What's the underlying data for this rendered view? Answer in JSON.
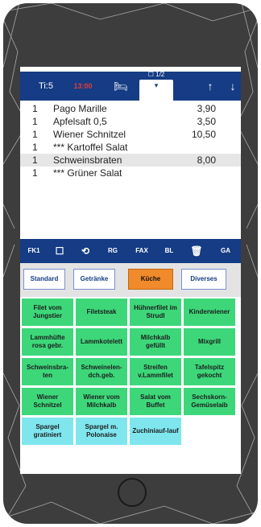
{
  "topbar": {
    "table": "Ti:5",
    "time": "13:00",
    "bed_icon": "bed-icon",
    "tab_label": "▾",
    "tab_sel": "☐ 1/2",
    "up_icon": "arrow-up-icon",
    "down_icon": "arrow-down-icon"
  },
  "orders": [
    {
      "qty": "1",
      "name": "Pago Marille",
      "price": "3,90"
    },
    {
      "qty": "1",
      "name": "Apfelsaft 0,5",
      "price": "3,50"
    },
    {
      "qty": "1",
      "name": "Wiener Schnitzel",
      "price": "10,50"
    },
    {
      "qty": "1",
      "name": "*** Kartoffel Salat",
      "price": ""
    },
    {
      "qty": "1",
      "name": "Schweinsbraten",
      "price": "8,00"
    },
    {
      "qty": "1",
      "name": "*** Grüner Salat",
      "price": ""
    }
  ],
  "funcbar": [
    "FK1",
    "☐",
    "⟲",
    "RG",
    "FAX",
    "BL",
    "🗑",
    "GA"
  ],
  "categories": [
    "Standard",
    "Getränke",
    "Küche",
    "Diverses"
  ],
  "items": [
    [
      "Filet vom Jungstier",
      "Filetsteak",
      "Hühnerfilet im Strudl",
      "Kinderwiener"
    ],
    [
      "Lammhüfte rosa gebr.",
      "Lammkotelett",
      "Milchkalb gefüllt",
      "Mixgrill"
    ],
    [
      "Schweinsbra-ten",
      "Schweinelen-dch.geb.",
      "Streifen v.Lammfilet",
      "Tafelspitz gekocht"
    ],
    [
      "Wiener Schnitzel",
      "Wiener vom Milchkalb",
      "Salat vom Buffet",
      "Sechskorn-Gemüselaib"
    ],
    [
      "Spargel gratiniert",
      "Spargel m. Polonaise",
      "Zuchiniauf-lauf",
      ""
    ]
  ],
  "colors": {
    "navy": "#153c84",
    "green": "#3dd77a",
    "cyan": "#7fe6ee",
    "orange": "#f08a2a"
  }
}
